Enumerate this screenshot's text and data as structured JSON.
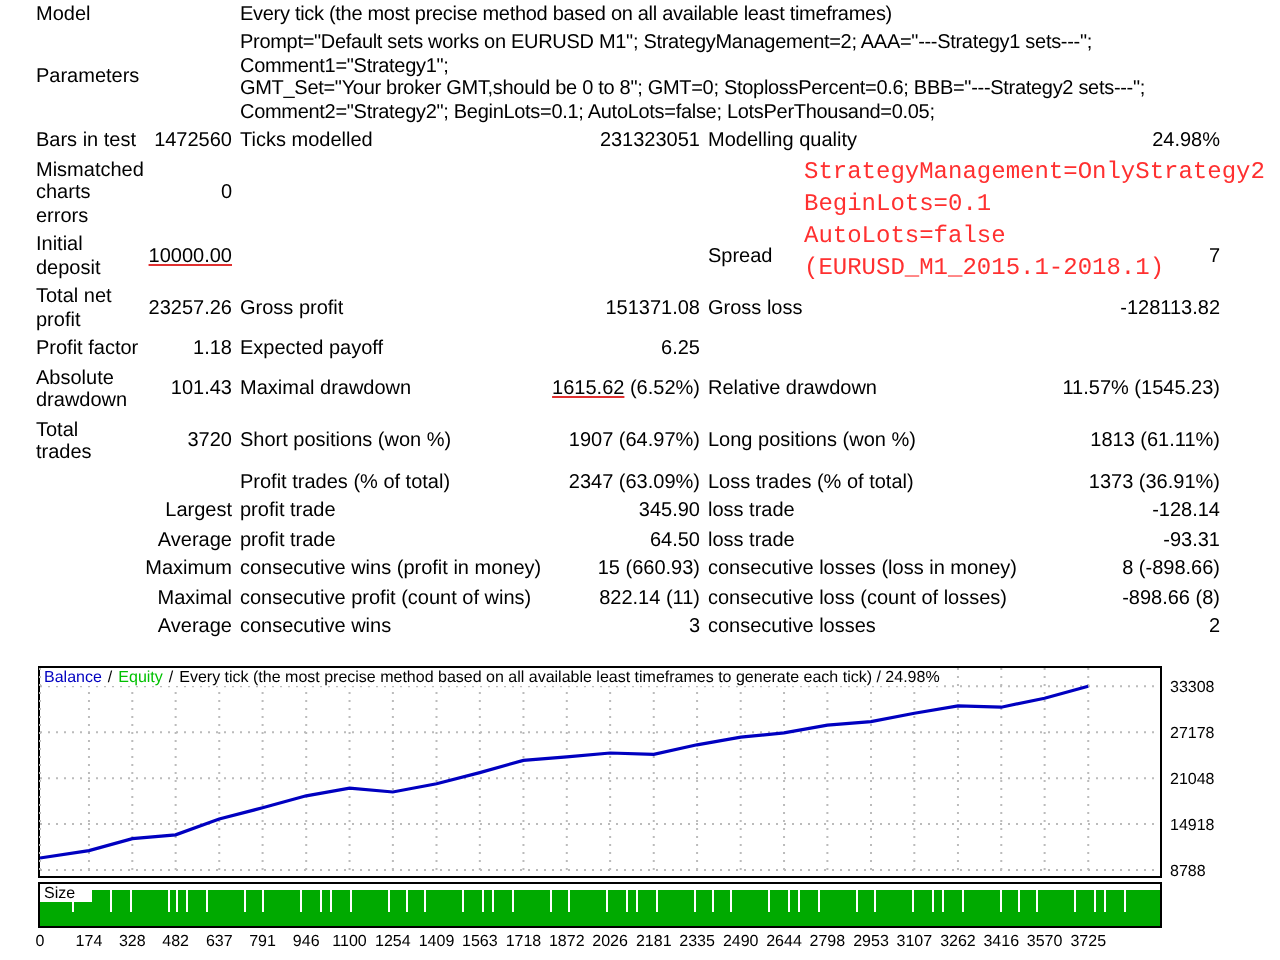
{
  "report": {
    "rows": [
      {
        "kind": "text",
        "label": "Model",
        "text": "Every tick (the most precise method based on all available least timeframes)"
      },
      {
        "kind": "text",
        "label": "Parameters",
        "text": "Prompt=\"Default sets works on EURUSD M1\"; StrategyManagement=2; AAA=\"---Strategy1 sets---\"; Comment1=\"Strategy1\";\nGMT_Set=\"Your broker GMT,should be 0 to 8\"; GMT=0; StoplossPercent=0.6; BBB=\"---Strategy2 sets---\";\nComment2=\"Strategy2\"; BeginLots=0.1; AutoLots=false; LotsPerThousand=0.05;"
      },
      {
        "kind": "stats",
        "label": "Bars in test",
        "value": "1472560",
        "label2": "Ticks modelled",
        "value2": "231323051",
        "label3": "Modelling quality",
        "value3": "24.98%"
      },
      {
        "kind": "stats",
        "label": "Mismatched\ncharts\nerrors",
        "value": "0"
      },
      {
        "kind": "stats",
        "label": "Initial\ndeposit",
        "value": "10000.00",
        "value_marked": true,
        "label3": "Spread",
        "value3": "7"
      },
      {
        "kind": "stats",
        "label": "Total net\nprofit",
        "value": "23257.26",
        "label2": "Gross profit",
        "value2": "151371.08",
        "label3": "Gross loss",
        "value3": "-128113.82"
      },
      {
        "kind": "stats",
        "label": "Profit factor",
        "value": "1.18",
        "label2": "Expected payoff",
        "value2": "6.25"
      },
      {
        "kind": "stats",
        "label": "Absolute\ndrawdown",
        "value": "101.43",
        "label2": "Maximal drawdown",
        "value2": "1615.62",
        "value2_rest": "(6.52%)",
        "value2_marked": true,
        "label3": "Relative drawdown",
        "value3": "11.57% (1545.23)"
      },
      {
        "kind": "stats",
        "label": "Total\ntrades",
        "value": "3720",
        "label2": "Short positions (won %)",
        "value2": "1907 (64.97%)",
        "label3": "Long positions (won %)",
        "value3": "1813 (61.11%)"
      },
      {
        "kind": "stats",
        "label2": "Profit trades (% of total)",
        "value2": "2347 (63.09%)",
        "label3": "Loss trades (% of total)",
        "value3": "1373 (36.91%)"
      },
      {
        "kind": "sub",
        "prefix": "Largest",
        "label2": "profit trade",
        "value2": "345.90",
        "label3": "loss trade",
        "value3": "-128.14"
      },
      {
        "kind": "sub",
        "prefix": "Average",
        "label2": "profit trade",
        "value2": "64.50",
        "label3": "loss trade",
        "value3": "-93.31"
      },
      {
        "kind": "sub",
        "prefix": "Maximum",
        "label2": "consecutive wins (profit in money)",
        "value2": "15 (660.93)",
        "label3": "consecutive losses (loss in money)",
        "value3": "8 (-898.66)"
      },
      {
        "kind": "sub",
        "prefix": "Maximal",
        "label2": "consecutive profit (count of wins)",
        "value2": "822.14 (11)",
        "label3": "consecutive loss (count of losses)",
        "value3": "-898.66 (8)"
      },
      {
        "kind": "sub",
        "prefix": "Average",
        "label2": "consecutive wins",
        "value2": "3",
        "label3": "consecutive losses",
        "value3": "2"
      }
    ]
  },
  "annotation": {
    "lines": [
      "StrategyManagement=OnlyStrategy2",
      "BeginLots=0.1",
      "AutoLots=false",
      "(EURUSD_M1_2015.1-2018.1)"
    ]
  },
  "chart": {
    "separators": [
      "/",
      "/"
    ],
    "caption": "Every tick (the most precise method based on all available least timeframes to generate each tick) / 24.98%",
    "size_label": "Size",
    "chart_data": {
      "type": "line",
      "grid": true,
      "x": [
        0,
        174,
        328,
        482,
        637,
        791,
        946,
        1100,
        1254,
        1409,
        1563,
        1718,
        1872,
        2026,
        2181,
        2335,
        2490,
        2644,
        2798,
        2953,
        3107,
        3262,
        3416,
        3570,
        3725
      ],
      "series": [
        {
          "name": "Balance",
          "color": "#0000c0",
          "values": [
            10400,
            11400,
            13000,
            13500,
            15600,
            17100,
            18700,
            19700,
            19200,
            20300,
            21800,
            23400,
            23900,
            24400,
            24200,
            25500,
            26500,
            27100,
            28100,
            28600,
            29700,
            30700,
            30500,
            31700,
            33300
          ]
        },
        {
          "name": "Equity",
          "color": "#00c000",
          "values": [
            null,
            null,
            null,
            null,
            null,
            null,
            null,
            null,
            null,
            null,
            null,
            null,
            null,
            null,
            null,
            null,
            null,
            null,
            null,
            null,
            null,
            null,
            null,
            null,
            null
          ]
        }
      ],
      "xlim": [
        0,
        3980
      ],
      "ylim": [
        8000,
        36000
      ],
      "xticks": [
        0,
        174,
        328,
        482,
        637,
        791,
        946,
        1100,
        1254,
        1409,
        1563,
        1718,
        1872,
        2026,
        2181,
        2335,
        2490,
        2644,
        2798,
        2953,
        3107,
        3262,
        3416,
        3570,
        3725
      ],
      "yticks": [
        8788,
        14918,
        21048,
        27178,
        33308
      ]
    }
  }
}
